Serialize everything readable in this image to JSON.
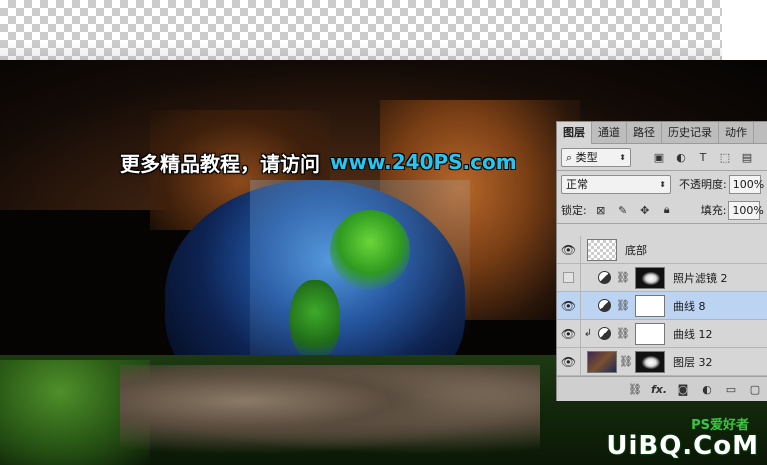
{
  "headline": {
    "text": "更多精品教程，请访问",
    "url": "www.240PS.com"
  },
  "logo": {
    "main": "UiBQ.CoM",
    "sub": "PS爱好者"
  },
  "layers_panel": {
    "tabs": [
      "图层",
      "通道",
      "路径",
      "历史记录",
      "动作"
    ],
    "active_tab": "图层",
    "filter": {
      "label": "类型",
      "icons": [
        "image-filter-icon",
        "adjustment-filter-icon",
        "type-filter-icon",
        "shape-filter-icon",
        "smart-object-filter-icon"
      ]
    },
    "blend_mode": "正常",
    "opacity_label": "不透明度:",
    "opacity_value": "100%",
    "lock_label": "锁定:",
    "fill_label": "填充:",
    "fill_value": "100%",
    "layers": [
      {
        "name": "底部",
        "visible": true,
        "selected": false,
        "type": "smart-object",
        "thumb": "checker"
      },
      {
        "name": "照片滤镜 2",
        "visible": false,
        "selected": false,
        "type": "adjustment",
        "thumb": "mask-dark"
      },
      {
        "name": "曲线 8",
        "visible": true,
        "selected": true,
        "type": "adjustment",
        "thumb": "white"
      },
      {
        "name": "曲线 12",
        "visible": true,
        "selected": false,
        "type": "adjustment-clipped",
        "thumb": "white"
      },
      {
        "name": "图层 32",
        "visible": true,
        "selected": false,
        "type": "pixel",
        "thumb": "photo"
      }
    ],
    "footer_icons": [
      "link-layers-icon",
      "fx-icon",
      "add-mask-icon",
      "adjustment-layer-icon",
      "new-group-icon",
      "new-layer-icon"
    ],
    "fx_label": "fx."
  }
}
